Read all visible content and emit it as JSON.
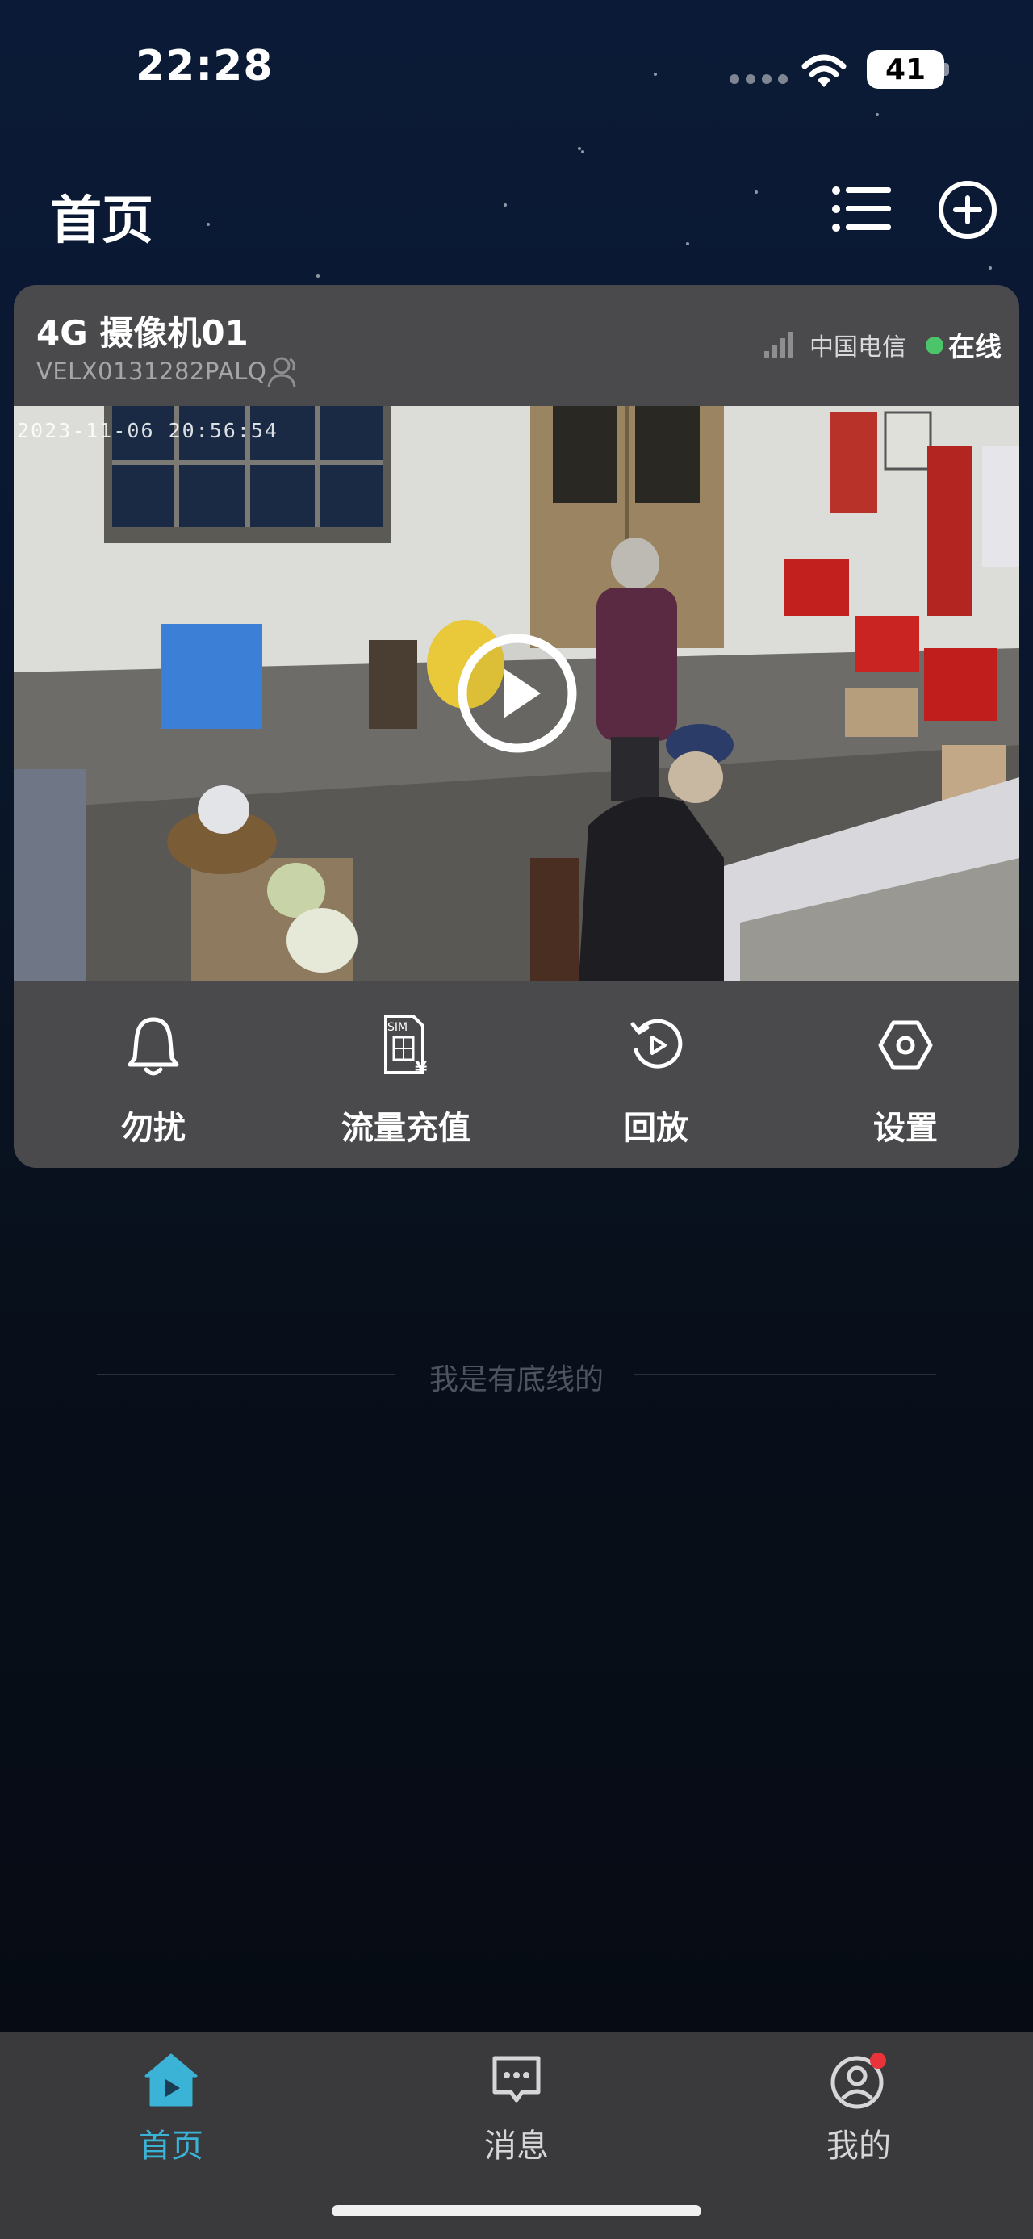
{
  "status_bar": {
    "time": "22:28",
    "battery": "41",
    "icons": [
      "signal-dots-icon",
      "wifi-icon",
      "battery-icon"
    ]
  },
  "header": {
    "title": "首页",
    "icons": [
      "list-icon",
      "add-circle-icon"
    ]
  },
  "device": {
    "name": "4G 摄像机01",
    "serial": "VELX0131282PALQ",
    "carrier": "中国电信",
    "status": "在线",
    "status_color": "#4bc46a",
    "video_timestamp": "2023-11-06 20:56:54",
    "actions": [
      {
        "label": "勿扰",
        "icon": "bell-icon"
      },
      {
        "label": "流量充值",
        "icon": "sim-card-recharge-icon"
      },
      {
        "label": "回放",
        "icon": "playback-icon"
      },
      {
        "label": "设置",
        "icon": "hexagon-settings-icon"
      }
    ]
  },
  "footer_note": "我是有底线的",
  "tab_bar": {
    "tabs": [
      {
        "label": "首页",
        "icon": "home-icon",
        "active": true
      },
      {
        "label": "消息",
        "icon": "message-icon",
        "active": false
      },
      {
        "label": "我的",
        "icon": "profile-icon",
        "active": false
      }
    ],
    "active_color": "#3ab3d6",
    "badge_color": "#e8333a"
  }
}
